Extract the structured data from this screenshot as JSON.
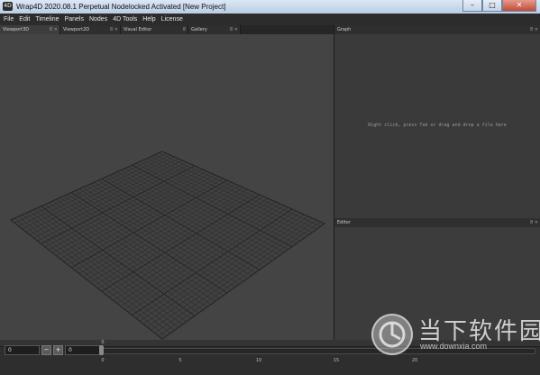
{
  "window": {
    "title": "Wrap4D 2020.08.1  Perpetual Nodelocked Activated  [New Project]",
    "app_icon": "4D",
    "controls": {
      "minimize": "–",
      "maximize": "□",
      "close": "✕"
    }
  },
  "menu": [
    "File",
    "Edit",
    "Timeline",
    "Panels",
    "Nodes",
    "4D Tools",
    "Help",
    "License"
  ],
  "tabs": [
    {
      "label": "Viewport3D",
      "controls": "8 ✕",
      "active": true
    },
    {
      "label": "Viewport2D",
      "controls": "8 ✕",
      "active": false
    },
    {
      "label": "Visual Editor",
      "controls": "8",
      "active": false
    },
    {
      "label": "Gallery",
      "controls": "8 ✕",
      "active": false
    }
  ],
  "graph": {
    "tab_label": "Graph",
    "controls": "8 ✕",
    "hint": "Right click, press Tab or drag and drop a file here"
  },
  "editor": {
    "tab_label": "Editor",
    "controls": "8 ✕"
  },
  "timeline": {
    "current_frame": "0",
    "minus_label": "−",
    "plus_label": "+",
    "end_frame": "0",
    "slider_value": 0,
    "tick_labels": [
      "0",
      "5",
      "10",
      "15",
      "20"
    ],
    "top_tick_label": "0"
  },
  "watermark": {
    "name": "当下软件园",
    "url": "www.downxia.com"
  },
  "colors": {
    "viewport_bg": "#444444",
    "grid_line": "#2e2e2e",
    "title_bar": "#c8d8ea",
    "close_button": "#c34a36"
  }
}
